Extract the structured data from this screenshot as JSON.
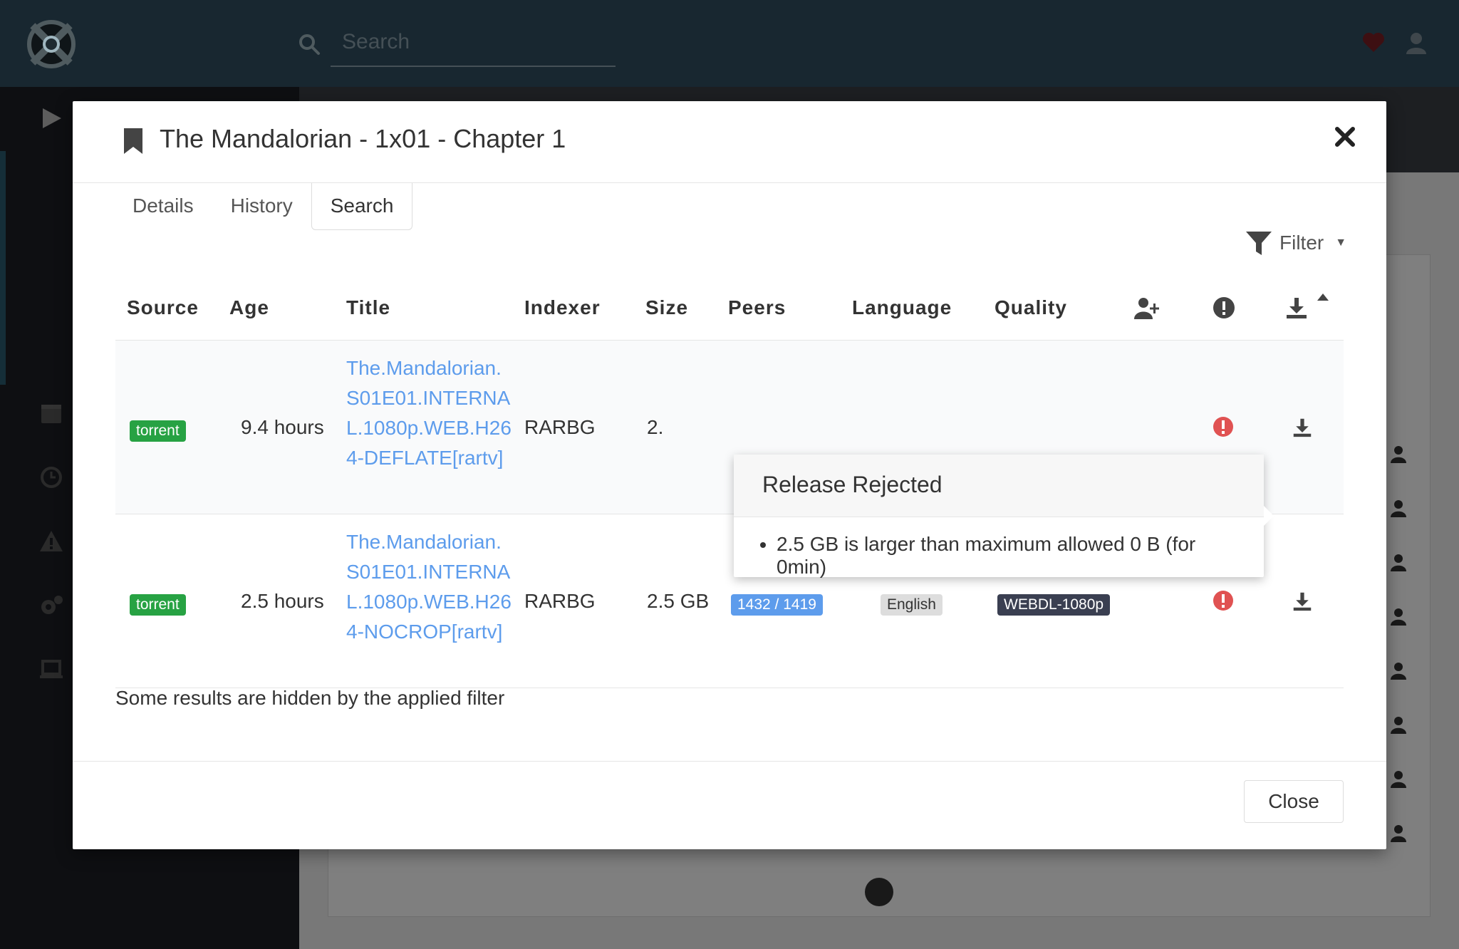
{
  "header": {
    "search_placeholder": "Search"
  },
  "modal": {
    "title": "The Mandalorian - 1x01 - Chapter 1",
    "tabs": [
      {
        "label": "Details"
      },
      {
        "label": "History"
      },
      {
        "label": "Search",
        "active": true
      }
    ],
    "filter_label": "Filter",
    "columns": {
      "source": "Source",
      "age": "Age",
      "title": "Title",
      "indexer": "Indexer",
      "size": "Size",
      "peers": "Peers",
      "language": "Language",
      "quality": "Quality"
    },
    "rows": [
      {
        "source": "torrent",
        "age": "9.4 hours",
        "title": "The.Mandalorian.S01E01.INTERNAL.1080p.WEB.H264-DEFLATE[rartv]",
        "indexer": "RARBG",
        "size_partial": "2."
      },
      {
        "source": "torrent",
        "age": "2.5 hours",
        "title": "The.Mandalorian.S01E01.INTERNAL.1080p.WEB.H264-NOCROP[rartv]",
        "indexer": "RARBG",
        "size": "2.5 GB",
        "peers": "1432 / 1419",
        "language": "English",
        "quality": "WEBDL-1080p"
      }
    ],
    "popover": {
      "title": "Release Rejected",
      "reason": "2.5 GB is larger than maximum allowed 0 B (for 0min)"
    },
    "hidden_note": "Some results are hidden by the applied filter",
    "close_button": "Close"
  },
  "colors": {
    "accent_link": "#5d9cec",
    "source_badge": "#27a243",
    "reject": "#e05252",
    "quality_badge": "#3a3f51"
  }
}
